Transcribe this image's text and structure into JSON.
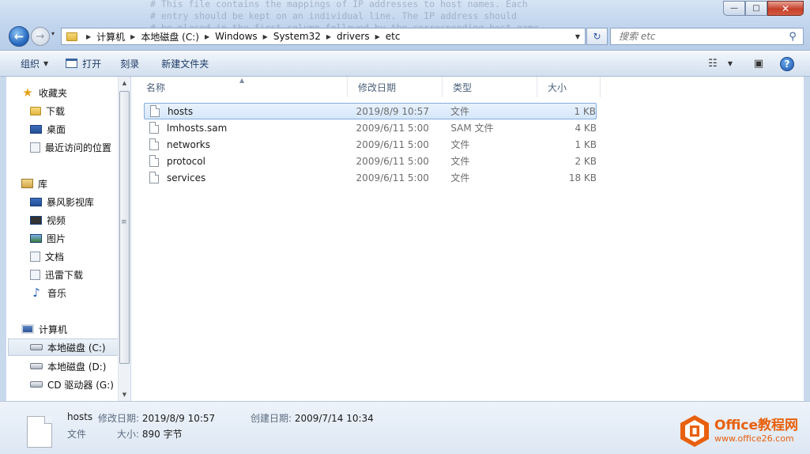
{
  "background_note_lines": [
    "# This file contains the mappings of IP addresses to host names. Each",
    "# entry should be kept on an individual line. The IP address should",
    "# be placed in the first column followed by the corresponding host name."
  ],
  "window": {
    "minimize": "—",
    "maximize": "□",
    "close": "✕"
  },
  "nav": {
    "back": "←",
    "forward": "→",
    "history": "▾"
  },
  "address": {
    "crumbs": [
      "计算机",
      "本地磁盘 (C:)",
      "Windows",
      "System32",
      "drivers",
      "etc"
    ],
    "refresh": "↻"
  },
  "search": {
    "placeholder": "搜索 etc"
  },
  "toolbar": {
    "organize": "组织",
    "open": "打开",
    "burn": "刻录",
    "new_folder": "新建文件夹"
  },
  "sidebar": {
    "favorites": {
      "title": "收藏夹",
      "items": [
        {
          "label": "下载",
          "icon": "download-folder-icon"
        },
        {
          "label": "桌面",
          "icon": "desktop-icon"
        },
        {
          "label": "最近访问的位置",
          "icon": "recent-places-icon"
        }
      ]
    },
    "libraries": {
      "title": "库",
      "items": [
        {
          "label": "暴风影视库",
          "icon": "video-library-icon"
        },
        {
          "label": "视频",
          "icon": "video-icon"
        },
        {
          "label": "图片",
          "icon": "picture-icon"
        },
        {
          "label": "文档",
          "icon": "document-icon"
        },
        {
          "label": "迅雷下载",
          "icon": "download-icon"
        },
        {
          "label": "音乐",
          "icon": "music-icon"
        }
      ]
    },
    "computer": {
      "title": "计算机",
      "items": [
        {
          "label": "本地磁盘 (C:)",
          "icon": "system-drive-icon",
          "selected": true
        },
        {
          "label": "本地磁盘 (D:)",
          "icon": "drive-icon"
        },
        {
          "label": "CD 驱动器 (G:)",
          "icon": "cd-drive-icon"
        }
      ]
    }
  },
  "columns": [
    "名称",
    "修改日期",
    "类型",
    "大小"
  ],
  "files": [
    {
      "name": "hosts",
      "date": "2019/8/9 10:57",
      "type": "文件",
      "size": "1 KB",
      "selected": true
    },
    {
      "name": "lmhosts.sam",
      "date": "2009/6/11 5:00",
      "type": "SAM 文件",
      "size": "4 KB"
    },
    {
      "name": "networks",
      "date": "2009/6/11 5:00",
      "type": "文件",
      "size": "1 KB"
    },
    {
      "name": "protocol",
      "date": "2009/6/11 5:00",
      "type": "文件",
      "size": "2 KB"
    },
    {
      "name": "services",
      "date": "2009/6/11 5:00",
      "type": "文件",
      "size": "18 KB"
    }
  ],
  "details": {
    "name": "hosts",
    "modified_label": "修改日期:",
    "modified_value": "2019/8/9 10:57",
    "created_label": "创建日期:",
    "created_value": "2009/7/14 10:34",
    "type": "文件",
    "size_label": "大小:",
    "size_value": "890 字节"
  },
  "watermark": {
    "line1": "Office教程网",
    "line2": "www.office26.com"
  },
  "colors": {
    "accent": "#1f5fb0",
    "selection": "#d6e7fb",
    "watermark": "#e8600c"
  }
}
